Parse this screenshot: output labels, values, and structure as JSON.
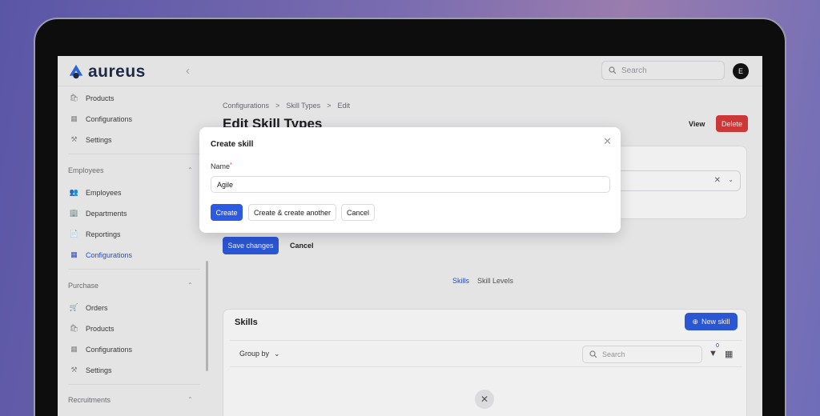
{
  "app": {
    "name": "aureus"
  },
  "topbar": {
    "search_placeholder": "Search",
    "avatar_initial": "E",
    "collapse_glyph": "‹"
  },
  "sidebar": {
    "top_items": [
      {
        "label": "Products",
        "icon": "bag-icon"
      },
      {
        "label": "Configurations",
        "icon": "grid-icon"
      },
      {
        "label": "Settings",
        "icon": "wrench-icon"
      }
    ],
    "groups": [
      {
        "label": "Employees",
        "items": [
          {
            "label": "Employees",
            "icon": "users-icon"
          },
          {
            "label": "Departments",
            "icon": "building-icon"
          },
          {
            "label": "Reportings",
            "icon": "report-icon"
          },
          {
            "label": "Configurations",
            "icon": "grid-icon",
            "active": true
          }
        ]
      },
      {
        "label": "Purchase",
        "items": [
          {
            "label": "Orders",
            "icon": "cart-icon"
          },
          {
            "label": "Products",
            "icon": "bag-icon"
          },
          {
            "label": "Configurations",
            "icon": "grid-icon"
          },
          {
            "label": "Settings",
            "icon": "wrench-icon"
          }
        ]
      },
      {
        "label": "Recruitments",
        "items": []
      }
    ]
  },
  "main": {
    "breadcrumb": [
      "Configurations",
      ">",
      "Skill Types",
      ">",
      "Edit"
    ],
    "title": "Edit Skill Types",
    "view_label": "View",
    "delete_label": "Delete",
    "save_label": "Save changes",
    "cancel_label": "Cancel",
    "tabs": [
      {
        "label": "Skills",
        "active": true
      },
      {
        "label": "Skill Levels",
        "active": false
      }
    ],
    "skills": {
      "title": "Skills",
      "new_label": "New skill",
      "group_by_label": "Group by",
      "search_placeholder": "Search",
      "filter_count": "0"
    }
  },
  "modal": {
    "title": "Create skill",
    "field_label": "Name",
    "required_mark": "*",
    "name_value": "Agile",
    "create_label": "Create",
    "create_another_label": "Create & create another",
    "cancel_label": "Cancel"
  },
  "colors": {
    "primary": "#2c5ae0",
    "danger": "#d93a3a",
    "brand": "#1c2b4a"
  }
}
